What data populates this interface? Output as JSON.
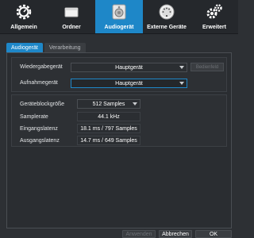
{
  "toolbar": {
    "tabs": [
      {
        "label": "Allgemein",
        "icon": "gear-icon"
      },
      {
        "label": "Ordner",
        "icon": "drive-icon"
      },
      {
        "label": "Audiogerät",
        "icon": "speaker-icon",
        "active": true
      },
      {
        "label": "Externe Geräte",
        "icon": "midi-port-icon"
      },
      {
        "label": "Erweitert",
        "icon": "gears-icon"
      }
    ]
  },
  "subtabs": {
    "audio": "Audiogerät",
    "processing": "Verarbeitung"
  },
  "devices": {
    "playback_label": "Wiedergabegerät",
    "playback_value": "Hauptgerät",
    "control_label": "Bedienfeld",
    "record_label": "Aufnahmegerät",
    "record_value": "Hauptgerät"
  },
  "settings": {
    "block_size_label": "Geräteblockgröße",
    "block_size_value": "512 Samples",
    "sample_rate_label": "Samplerate",
    "sample_rate_value": "44.1 kHz",
    "input_latency_label": "Eingangslatenz",
    "input_latency_value": "18.1 ms / 797 Samples",
    "output_latency_label": "Ausgangslatenz",
    "output_latency_value": "14.7 ms / 649 Samples"
  },
  "footer": {
    "apply": "Anwenden",
    "cancel": "Abbrechen",
    "ok": "OK"
  },
  "colors": {
    "accent": "#1e87c8",
    "background": "#2d3034"
  }
}
